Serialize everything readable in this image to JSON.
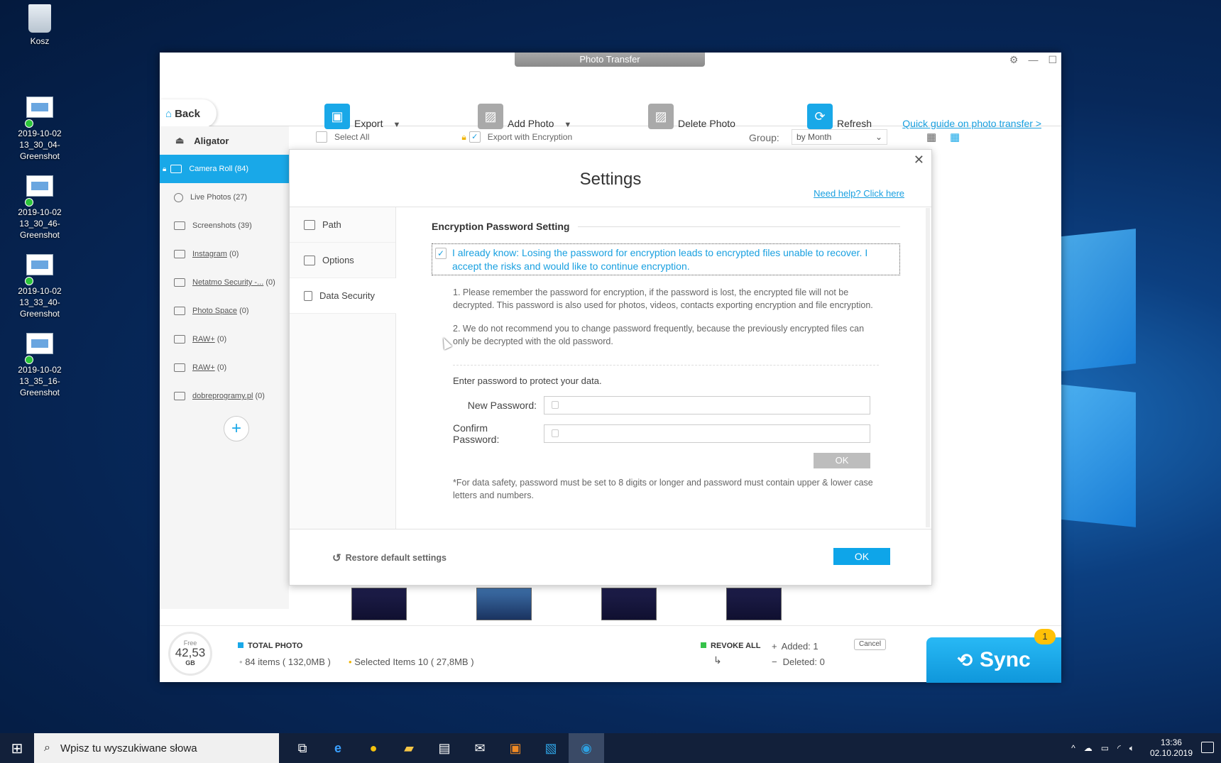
{
  "desktop": {
    "icons": [
      {
        "label": "Kosz"
      },
      {
        "label": "2019-10-02 13_30_04-Greenshot"
      },
      {
        "label": "2019-10-02 13_30_46-Greenshot"
      },
      {
        "label": "2019-10-02 13_33_40-Greenshot"
      },
      {
        "label": "2019-10-02 13_35_16-Greenshot"
      }
    ]
  },
  "window": {
    "title": "Photo Transfer"
  },
  "toolbar": {
    "back": "Back",
    "export": "Export",
    "add_photo": "Add Photo",
    "delete_photo": "Delete Photo",
    "refresh": "Refresh",
    "quick_guide": "Quick guide on photo transfer >"
  },
  "sidebar": {
    "device": "Aligator",
    "items": [
      {
        "label": "Camera Roll (84)"
      },
      {
        "label": "Live Photos (27)"
      },
      {
        "label": "Screenshots (39)"
      },
      {
        "label": "Instagram",
        "count": "(0)"
      },
      {
        "label": "Netatmo Security -...",
        "count": "(0)"
      },
      {
        "label": "Photo Space",
        "count": "(0)"
      },
      {
        "label": "RAW+",
        "count": "(0)"
      },
      {
        "label": "RAW+",
        "count": "(0)"
      },
      {
        "label": "dobreprogramy.pl",
        "count": "(0)"
      }
    ]
  },
  "subbar": {
    "select_all": "Select All",
    "export_encryption": "Export with Encryption",
    "group_label": "Group:",
    "group_value": "by Month"
  },
  "bottom": {
    "free_label": "Free",
    "free_value": "42,53",
    "free_unit": "GB",
    "total_photo": "TOTAL PHOTO",
    "items": "84 items ( 132,0MB )",
    "selected": "Selected Items 10 ( 27,8MB )",
    "revoke_all": "REVOKE ALL",
    "added": "Added: 1",
    "deleted": "Deleted: 0",
    "cancel": "Cancel",
    "sync": "Sync",
    "sync_badge": "1"
  },
  "modal": {
    "title": "Settings",
    "help": "Need help? Click here",
    "nav": [
      {
        "label": "Path"
      },
      {
        "label": "Options"
      },
      {
        "label": "Data Security"
      }
    ],
    "section_title": "Encryption Password Setting",
    "agree": "I already know: Losing the password for encryption leads to encrypted files unable to recover. I accept the risks and would like to continue encryption.",
    "note1": "1. Please remember the password for encryption, if the password is lost, the encrypted file will not be decrypted. This password is also used for photos, videos, contacts exporting encryption and file encryption.",
    "note2": "2. We do not recommend you to change password frequently, because the previously encrypted files can only be decrypted with the old password.",
    "enter_password": "Enter password to protect your data.",
    "new_password": "New Password:",
    "confirm_password": "Confirm Password:",
    "pw_ok": "OK",
    "safety": "*For data safety, password must be set to 8 digits or longer and password must contain upper & lower case letters and numbers.",
    "restore": "Restore default settings",
    "ok": "OK"
  },
  "taskbar": {
    "search_placeholder": "Wpisz tu wyszukiwane słowa",
    "time": "13:36",
    "date": "02.10.2019"
  }
}
